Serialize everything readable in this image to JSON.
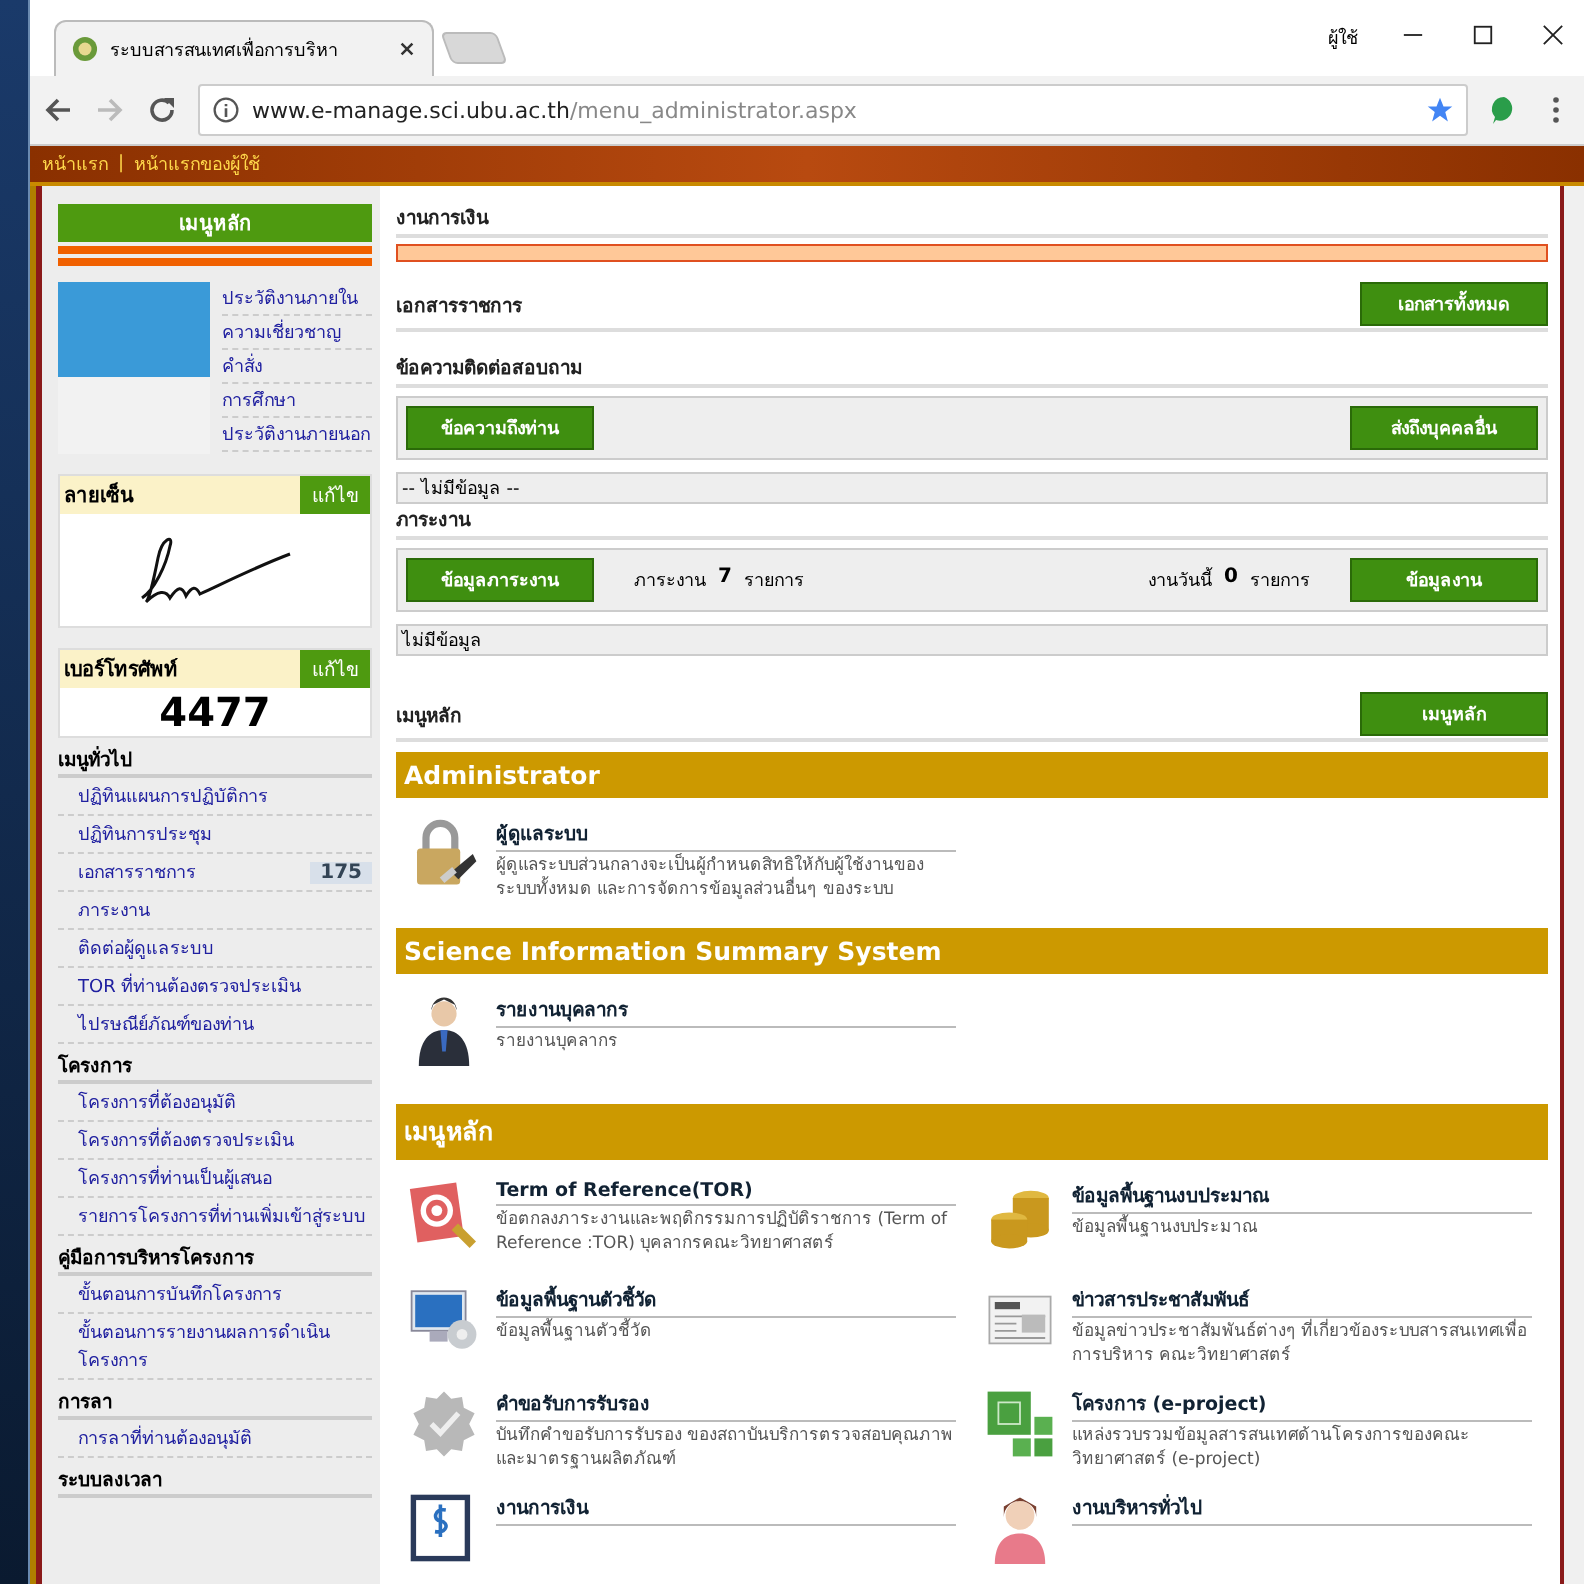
{
  "browser": {
    "tab_title": "ระบบสารสนเทศเพื่อการบริหา",
    "user_label": "ผู้ใช้",
    "url_host": "www.e-manage.sci.ubu.ac.th",
    "url_path": "/menu_administrator.aspx"
  },
  "top_links": [
    "หน้าแรก",
    "หน้าแรกของผู้ใช้"
  ],
  "top_links_separator": "|",
  "sidebar": {
    "title": "เมนูหลัก",
    "profile_links": [
      "ประวัติงานภายใน",
      "ความเชี่ยวชาญ",
      "คำสั่ง",
      "การศึกษา",
      "ประวัติงานภายนอก"
    ],
    "signature": {
      "label": "ลายเซ็น",
      "edit": "แก้ไข"
    },
    "phone": {
      "label": "เบอร์โทรศัพท์",
      "edit": "แก้ไข",
      "number": "4477"
    },
    "groups": [
      {
        "title": "เมนูทั่วไป",
        "items": [
          {
            "label": "ปฏิทินแผนการปฏิบัติการ"
          },
          {
            "label": "ปฏิทินการประชุม"
          },
          {
            "label": "เอกสารราชการ",
            "badge": "175"
          },
          {
            "label": "ภาระงาน"
          },
          {
            "label": "ติดต่อผู้ดูแลระบบ"
          },
          {
            "label": "TOR ที่ท่านต้องตรวจประเมิน"
          },
          {
            "label": "ไปรษณีย์ภัณฑ์ของท่าน"
          }
        ]
      },
      {
        "title": "โครงการ",
        "items": [
          {
            "label": "โครงการที่ต้องอนุมัติ"
          },
          {
            "label": "โครงการที่ต้องตรวจประเมิน"
          },
          {
            "label": "โครงการที่ท่านเป็นผู้เสนอ"
          },
          {
            "label": "รายการโครงการที่ท่านเพิ่มเข้าสู่ระบบ"
          }
        ]
      },
      {
        "title": "คู่มือการบริหารโครงการ",
        "items": [
          {
            "label": "ขั้นตอนการบันทึกโครงการ"
          },
          {
            "label": "ขั้นตอนการรายงานผลการดำเนินโครงการ"
          }
        ]
      },
      {
        "title": "การลา",
        "items": [
          {
            "label": "การลาที่ท่านต้องอนุมัติ"
          }
        ]
      },
      {
        "title": "ระบบลงเวลา"
      }
    ]
  },
  "main": {
    "finance": {
      "title": "งานการเงิน"
    },
    "documents": {
      "title": "เอกสารราชการ",
      "button": "เอกสารทั้งหมด"
    },
    "messages": {
      "title": "ข้อความติดต่อสอบถาม",
      "button_left": "ข้อความถึงท่าน",
      "button_right": "ส่งถึงบุคคลอื่น",
      "empty_text": "-- ไม่มีข้อมูล --"
    },
    "workload": {
      "title": "ภาระงาน",
      "button_left": "ข้อมูลภาระงาน",
      "count_label": "ภาระงาน",
      "count": "7",
      "count_unit": "รายการ",
      "today_label": "งานวันนี้",
      "today_count": "0",
      "today_unit": "รายการ",
      "button_right": "ข้อมูลงาน",
      "empty_text": "ไม่มีข้อมูล"
    },
    "menu": {
      "title": "เมนูหลัก",
      "button": "เมนูหลัก"
    },
    "groups": [
      {
        "title": "Administrator",
        "items": [
          {
            "kind": "lock",
            "title": "ผู้ดูแลระบบ",
            "desc": "ผู้ดูแลระบบส่วนกลางจะเป็นผู้กำหนดสิทธิให้กับผู้ใช้งานของระบบทั้งหมด และการจัดการข้อมูลส่วนอื่นๆ ของระบบ"
          }
        ]
      },
      {
        "title": "Science Information Summary System",
        "items": [
          {
            "kind": "person",
            "title": "รายงานบุคลากร",
            "desc": "รายงานบุคลากร"
          }
        ]
      },
      {
        "title": "เมนูหลัก",
        "items": [
          {
            "kind": "target",
            "title": "Term of Reference(TOR)",
            "desc": "ข้อตกลงภาระงานและพฤติกรรมการปฏิบัติราชการ (Term of Reference :TOR) บุคลากรคณะวิทยาศาสตร์"
          },
          {
            "kind": "coins",
            "title": "ข้อมูลพื้นฐานงบประมาณ",
            "desc": "ข้อมูลพื้นฐานงบประมาณ"
          },
          {
            "kind": "monitor",
            "title": "ข้อมูลพื้นฐานตัวชี้วัด",
            "desc": "ข้อมูลพื้นฐานตัวชี้วัด"
          },
          {
            "kind": "newspaper",
            "title": "ข่าวสารประชาสัมพันธ์",
            "desc": "ข้อมูลข่าวประชาสัมพันธ์ต่างๆ ที่เกี่ยวข้องระบบสารสนเทศเพื่อการบริหาร คณะวิทยาศาสตร์"
          },
          {
            "kind": "seal",
            "title": "คำขอรับการรับรอง",
            "desc": "บันทึกคำขอรับการรับรอง ของสถาบันบริการตรวจสอบคุณภาพและมาตรฐานผลิตภัณฑ์"
          },
          {
            "kind": "blocks",
            "title": "โครงการ (e-project)",
            "desc": "แหล่งรวบรวมข้อมูลสารสนเทศด้านโครงการของคณะวิทยาศาสตร์ (e-project)"
          },
          {
            "kind": "dollar",
            "title": "งานการเงิน"
          },
          {
            "kind": "woman",
            "title": "งานบริหารทั่วไป"
          }
        ]
      }
    ]
  }
}
